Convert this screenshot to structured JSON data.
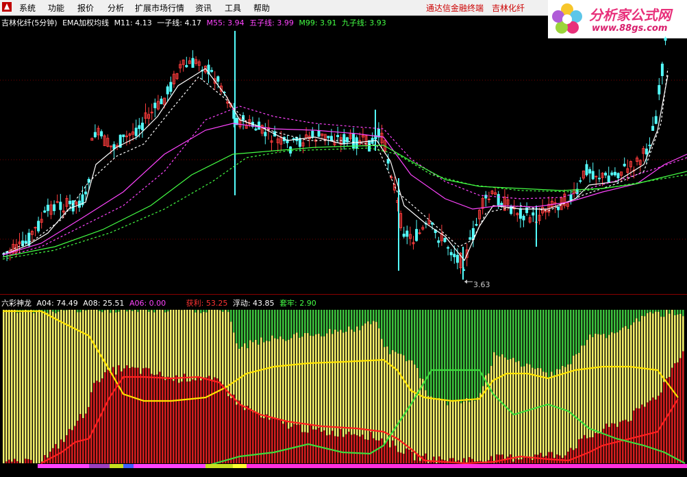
{
  "menu": {
    "items": [
      "系统",
      "功能",
      "报价",
      "分析",
      "扩展市场行情",
      "资讯",
      "工具",
      "帮助"
    ],
    "right": [
      "通达信金融终端",
      "吉林化纤"
    ]
  },
  "brand": {
    "title": "分析家公式网",
    "url": "www.88gs.com"
  },
  "main_panel": {
    "stock_title": "吉林化纤(5分钟)",
    "indicator_name": "EMA加权均线",
    "values": [
      {
        "label": "M11: 4.13",
        "color": "#ffffff"
      },
      {
        "label": "一子线: 4.17",
        "color": "#ffffff"
      },
      {
        "label": "M55: 3.94",
        "color": "#ff44ff"
      },
      {
        "label": "五子线: 3.99",
        "color": "#ff44ff"
      },
      {
        "label": "M99: 3.91",
        "color": "#44ff44"
      },
      {
        "label": "九子线: 3.93",
        "color": "#44ff44"
      }
    ],
    "low_label": "3.63"
  },
  "sub_panel": {
    "indicator_name": "六彩神龙",
    "values": [
      {
        "label": "A04: 74.49",
        "color": "#ffffff"
      },
      {
        "label": "A08: 25.51",
        "color": "#ffffff"
      },
      {
        "label": "A06: 0.00",
        "color": "#ff44ff"
      },
      {
        "label": "获利: 53.25",
        "color": "#ff3333"
      },
      {
        "label": "浮动: 43.85",
        "color": "#ffffff"
      },
      {
        "label": "套牢: 2.90",
        "color": "#44ff44"
      }
    ]
  },
  "colors": {
    "up_candle": "#ff3c3c",
    "down_candle": "#54ffff",
    "ma_white": "#ffffff",
    "ma_magenta": "#ff44ff",
    "ma_green": "#44ff44",
    "profit_red": "#d41f1f",
    "float_yellow": "#f5f06a",
    "trapped_green": "#3dc13d",
    "line_yellow": "#ffe400",
    "line_red": "#ff2020",
    "line_green": "#3ddc3d",
    "grid": "#7a0000"
  }
}
